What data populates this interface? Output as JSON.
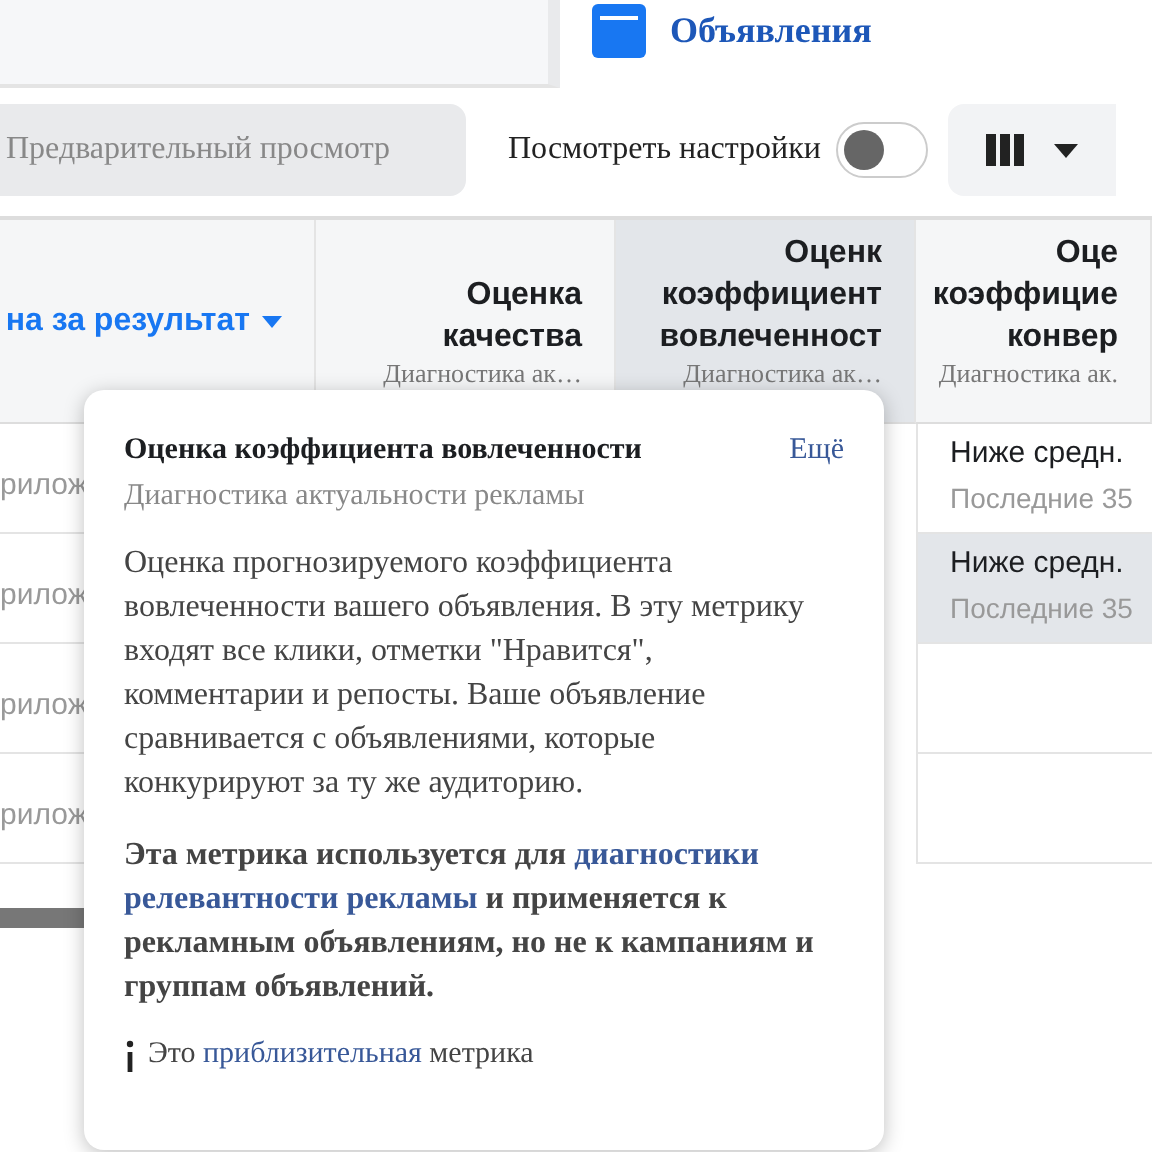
{
  "top": {
    "title": "Объявления"
  },
  "toolbar": {
    "preview_placeholder": "Предварительный просмотр",
    "toggle": {
      "label": "Посмотреть настройки",
      "on": false
    }
  },
  "table": {
    "columns": [
      {
        "title": "на за результат",
        "sortable": true,
        "highlighted": false
      },
      {
        "title": "Оценка\nкачества",
        "subtitle": "Диагностика ак…",
        "sortable": false,
        "highlighted": false
      },
      {
        "title": "Оценк\nкоэффициент\nвовлеченност",
        "subtitle": "Диагностика ак…",
        "sortable": false,
        "highlighted": true
      },
      {
        "title": "Оце\nкоэффицие\nконвер",
        "subtitle": "Диагностика ак.",
        "sortable": false,
        "highlighted": false
      }
    ],
    "rows": [
      {
        "cells": [
          "рилож",
          "",
          "",
          "Ниже средн."
        ],
        "note": "Последние 35",
        "selected": false
      },
      {
        "cells": [
          "рилож",
          "",
          "",
          "Ниже средн."
        ],
        "note": "Последние 35",
        "selected": true
      },
      {
        "cells": [
          "рилож",
          "",
          "",
          ""
        ],
        "selected": false
      },
      {
        "cells": [
          "рилож",
          "",
          "",
          ""
        ],
        "selected": false
      }
    ]
  },
  "tooltip": {
    "title": "Оценка коэффициента вовлеченности",
    "more_link": "Ещё",
    "subtitle": "Диагностика актуальности рекламы",
    "body": "Оценка прогнозируемого коэффициента вовлеченности вашего объявления. В эту метрику входят все клики, отметки \"Нравится\", комментарии и репосты. Ваше объявление сравнивается с объявлениями, которые конкурируют за ту же аудиторию.",
    "note": [
      {
        "kind": "text",
        "text": "Эта метрика используется для "
      },
      {
        "kind": "link",
        "text": "диагностики"
      },
      {
        "kind": "link",
        "text": "релевантности рекламы"
      },
      {
        "kind": "text",
        "text": " и применяется к рекламным объявлениям, но не к кампаниям и группам объявлений."
      }
    ],
    "footer": [
      {
        "kind": "text",
        "text": "Это "
      },
      {
        "kind": "link",
        "text": "приблизительная"
      },
      {
        "kind": "text",
        "text": " метрика"
      }
    ]
  }
}
